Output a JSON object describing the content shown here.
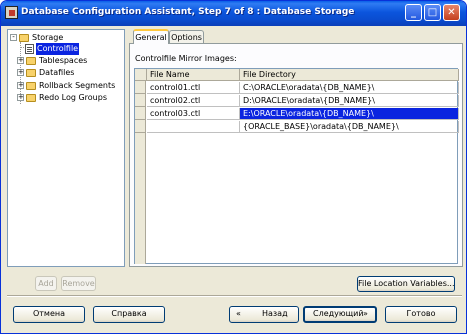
{
  "window": {
    "title": "Database Configuration Assistant, Step 7 of 8 : Database Storage",
    "minimize_glyph": "_",
    "maximize_glyph": "□",
    "close_glyph": "✕"
  },
  "tree": {
    "root": {
      "label": "Storage",
      "expander": "-"
    },
    "items": [
      {
        "label": "Controlfile",
        "selected": true,
        "icon": "document-icon"
      },
      {
        "label": "Tablespaces",
        "expander": "+",
        "icon": "folder-icon"
      },
      {
        "label": "Datafiles",
        "expander": "+",
        "icon": "folder-icon"
      },
      {
        "label": "Rollback Segments",
        "expander": "+",
        "icon": "folder-icon"
      },
      {
        "label": "Redo Log Groups",
        "expander": "+",
        "icon": "folder-icon"
      }
    ]
  },
  "tree_buttons": {
    "add": "Add",
    "remove": "Remove"
  },
  "tabs": [
    {
      "label": "General",
      "active": true
    },
    {
      "label": "Options",
      "active": false
    }
  ],
  "panel": {
    "label": "Controlfile Mirror Images:",
    "columns": [
      "File Name",
      "File Directory"
    ],
    "rows": [
      {
        "name": "control01.ctl",
        "dir": "C:\\ORACLE\\oradata\\{DB_NAME}\\",
        "selected": false
      },
      {
        "name": "control02.ctl",
        "dir": "D:\\ORACLE\\oradata\\{DB_NAME}\\",
        "selected": false
      },
      {
        "name": "control03.ctl",
        "dir": "E:\\ORACLE\\oradata\\{DB_NAME}\\",
        "selected": true
      },
      {
        "name": "",
        "dir": "{ORACLE_BASE}\\oradata\\{DB_NAME}\\",
        "selected": false
      }
    ]
  },
  "buttons": {
    "file_location": "File Location Variables...",
    "cancel": "Отмена",
    "help": "Справка",
    "back": "Назад",
    "next": "Следующий",
    "finish": "Готово",
    "back_arrow": "«",
    "next_arrow": "»"
  },
  "colors": {
    "title_bar": "#0a4ccf",
    "selection": "#0a24e0",
    "window_bg": "#ece9d8"
  }
}
